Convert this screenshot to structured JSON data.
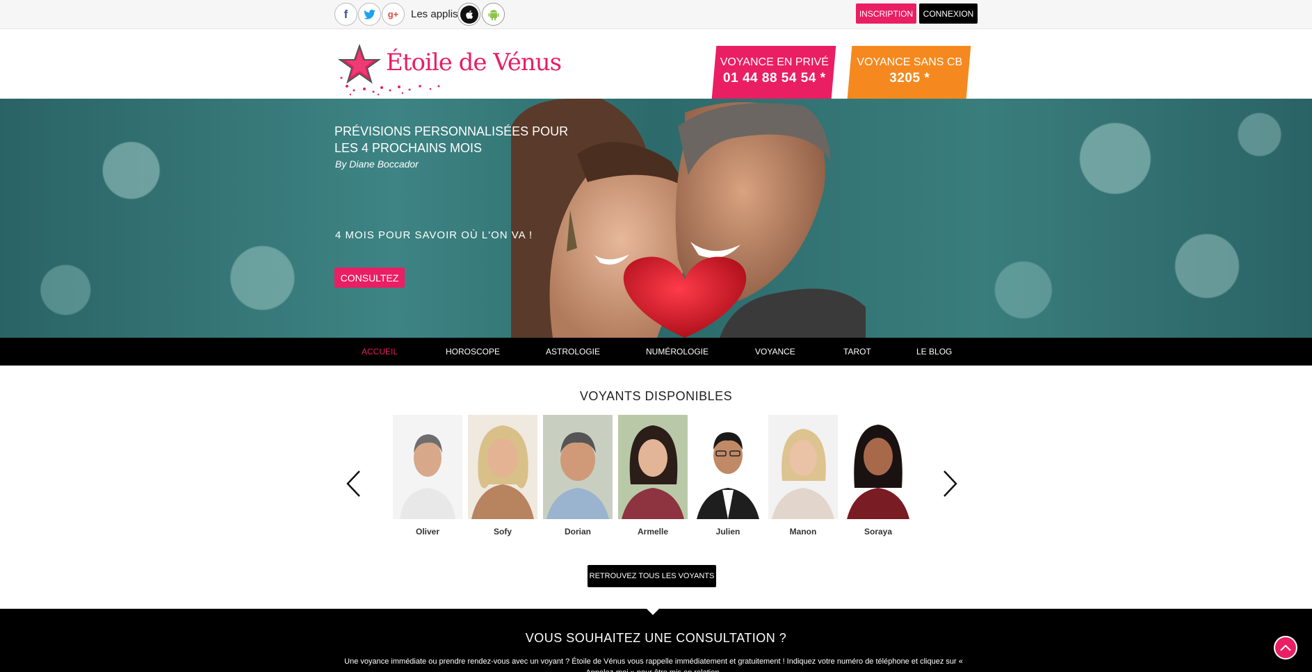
{
  "topbar": {
    "social": [
      {
        "name": "facebook-icon",
        "glyph": "f"
      },
      {
        "name": "twitter-icon",
        "glyph": "t"
      },
      {
        "name": "google-plus-icon",
        "glyph": "g+"
      }
    ],
    "apps_label": "Les applis",
    "inscription": "INSCRIPTION",
    "connexion": "CONNEXION"
  },
  "header": {
    "logo_text": "Étoile de Vénus",
    "promo_prive": {
      "line1": "VOYANCE EN PRIVÉ",
      "line2": "01 44 88 54 54 *"
    },
    "promo_cb": {
      "line1": "VOYANCE SANS CB",
      "line2": "3205 *"
    },
    "colors": {
      "pink": "#ea1e63",
      "orange": "#f5891f"
    }
  },
  "hero": {
    "title": "PRÉVISIONS PERSONNALISÉES POUR LES 4 PROCHAINS MOIS",
    "by": "By Diane Boccador",
    "tagline": "4 MOIS POUR SAVOIR OÙ L'ON VA !",
    "cta": "CONSULTEZ"
  },
  "nav": {
    "items": [
      "ACCUEIL",
      "HOROSCOPE",
      "ASTROLOGIE",
      "NUMÉROLOGIE",
      "VOYANCE",
      "TAROT",
      "LE BLOG"
    ],
    "active": "ACCUEIL"
  },
  "voyants": {
    "title": "VOYANTS DISPONIBLES",
    "people": [
      "Oliver",
      "Sofy",
      "Dorian",
      "Armelle",
      "Julien",
      "Manon",
      "Soraya"
    ],
    "button": "RETROUVEZ TOUS LES VOYANTS"
  },
  "consultation": {
    "title": "VOUS SOUHAITEZ UNE CONSULTATION ?",
    "text": "Une voyance immédiate ou prendre rendez-vous avec un voyant ? Étoile de Vénus vous rappelle immédiatement et gratuitement ! Indiquez votre numéro de téléphone et cliquez sur « Appelez-moi » pour être mis en relation."
  }
}
